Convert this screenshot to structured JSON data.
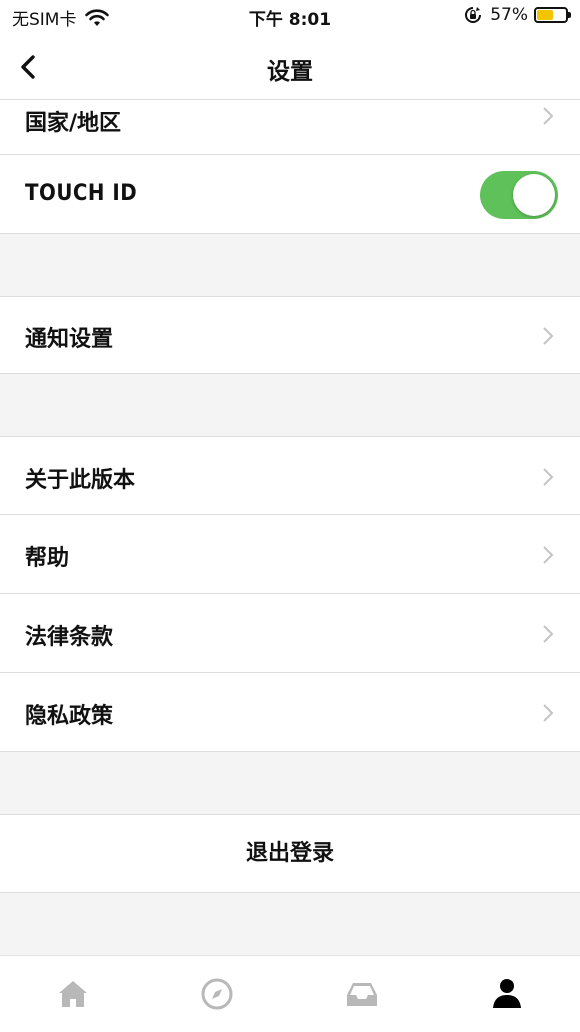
{
  "status_bar": {
    "carrier": "无SIM卡",
    "time": "下午 8:01",
    "battery_percent": "57%",
    "battery_level": 0.57,
    "wifi_icon": "wifi-icon",
    "rotation_lock_icon": "rotation-lock-icon"
  },
  "nav": {
    "title": "设置",
    "back_icon": "chevron-left-icon"
  },
  "rows": {
    "country": "国家/地区",
    "touch_id": "TOUCH ID",
    "touch_id_enabled": true,
    "notifications": "通知设置",
    "about": "关于此版本",
    "help": "帮助",
    "legal": "法律条款",
    "privacy": "隐私政策",
    "logout": "退出登录"
  },
  "tabs": [
    {
      "icon": "home-icon",
      "active": false
    },
    {
      "icon": "compass-icon",
      "active": false
    },
    {
      "icon": "inbox-icon",
      "active": false
    },
    {
      "icon": "profile-icon",
      "active": true
    }
  ],
  "colors": {
    "toggle_on": "#5fc15a",
    "battery_fill": "#f2c500",
    "tab_inactive": "#b8b8b8",
    "tab_active": "#000000"
  }
}
